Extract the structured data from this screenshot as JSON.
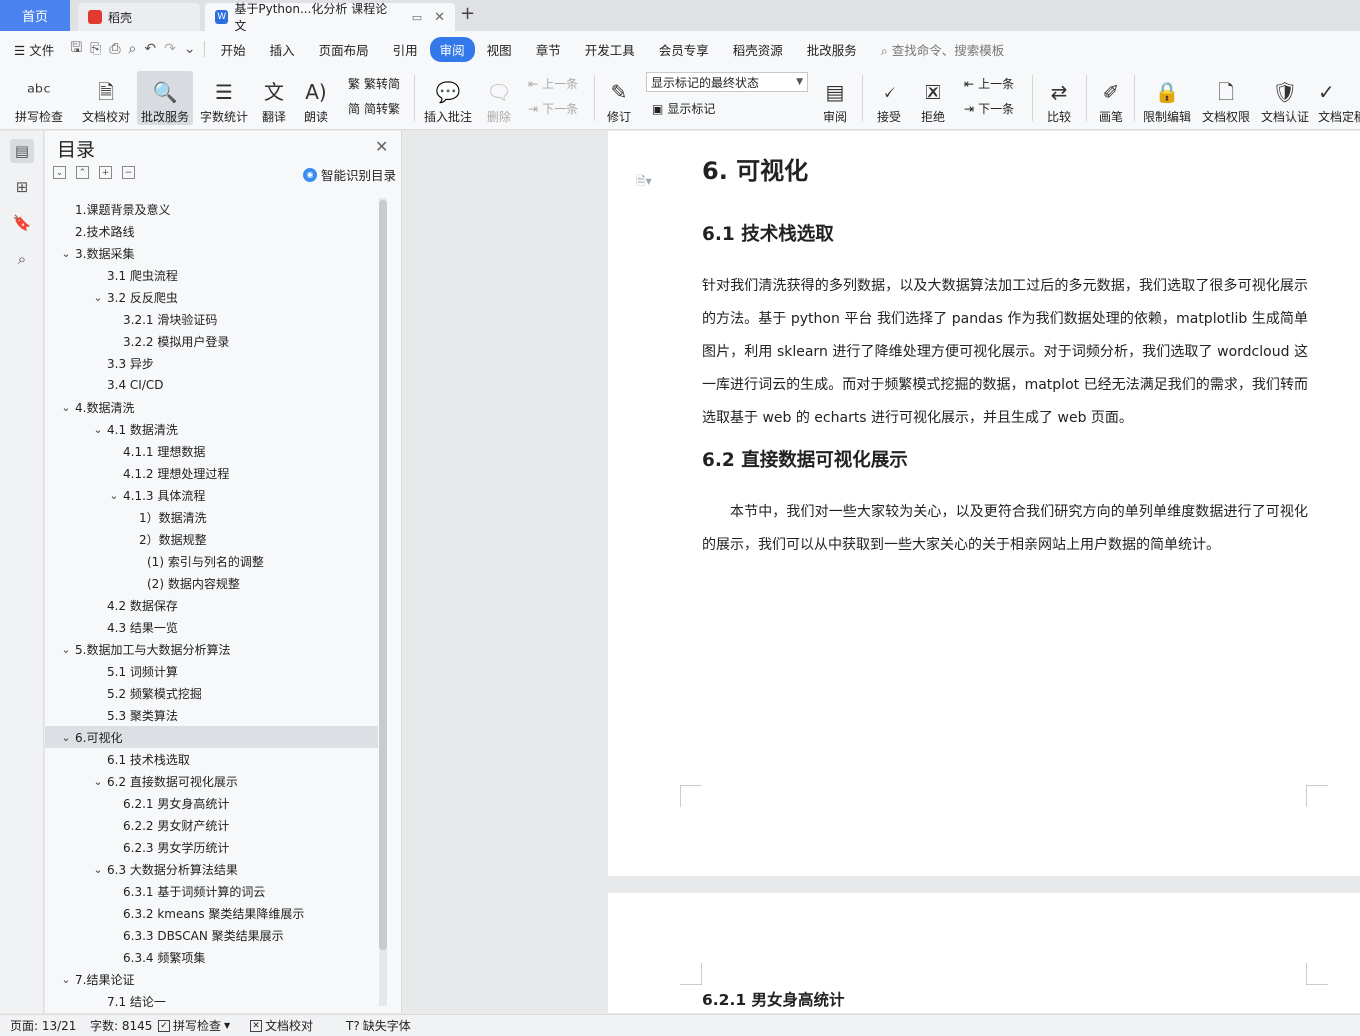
{
  "tabs": {
    "home": "首页",
    "daoke": "稻壳",
    "doc": "基于Python...化分析 课程论文"
  },
  "menu": {
    "file": "文件",
    "items": [
      "开始",
      "插入",
      "页面布局",
      "引用",
      "审阅",
      "视图",
      "章节",
      "开发工具",
      "会员专享",
      "稻壳资源",
      "批改服务"
    ],
    "active": "审阅",
    "search_placeholder": "查找命令、搜索模板"
  },
  "ribbon": {
    "spellcheck": "拼写检查",
    "doc_check": "文档校对",
    "review_service": "批改服务",
    "word_count": "字数统计",
    "translate": "翻译",
    "read_aloud": "朗读",
    "to_traditional": "繁转简",
    "to_simplified": "简转繁",
    "insert_comment": "插入批注",
    "delete": "删除",
    "prev": "上一条",
    "next": "下一条",
    "revise": "修订",
    "markup_state": "显示标记的最终状态",
    "show_markup": "显示标记",
    "review": "审阅",
    "accept": "接受",
    "reject": "拒绝",
    "prev2": "上一条",
    "next2": "下一条",
    "compare": "比较",
    "pen": "画笔",
    "restrict_edit": "限制编辑",
    "doc_permission": "文档权限",
    "doc_certify": "文档认证",
    "doc_final": "文档定稿"
  },
  "toc": {
    "title": "目录",
    "smart": "智能识别目录",
    "items": [
      {
        "label": "1.课题背景及意义",
        "level": 0,
        "caret": ""
      },
      {
        "label": "2.技术路线",
        "level": 0,
        "caret": ""
      },
      {
        "label": "3.数据采集",
        "level": 0,
        "caret": "v"
      },
      {
        "label": "3.1  爬虫流程",
        "level": 1,
        "caret": ""
      },
      {
        "label": "3.2  反反爬虫",
        "level": 1,
        "caret": "v"
      },
      {
        "label": "3.2.1  滑块验证码",
        "level": 2,
        "caret": ""
      },
      {
        "label": "3.2.2  模拟用户登录",
        "level": 2,
        "caret": ""
      },
      {
        "label": "3.3  异步",
        "level": 1,
        "caret": ""
      },
      {
        "label": "3.4 CI/CD",
        "level": 1,
        "caret": ""
      },
      {
        "label": "4.数据清洗",
        "level": 0,
        "caret": "v"
      },
      {
        "label": "4.1  数据清洗",
        "level": 1,
        "caret": "v"
      },
      {
        "label": "4.1.1  理想数据",
        "level": 2,
        "caret": ""
      },
      {
        "label": "4.1.2  理想处理过程",
        "level": 2,
        "caret": ""
      },
      {
        "label": "4.1.3  具体流程",
        "level": 2,
        "caret": "v"
      },
      {
        "label": "1）数据清洗",
        "level": 3,
        "caret": ""
      },
      {
        "label": "2）数据规整",
        "level": 3,
        "caret": ""
      },
      {
        "label": "(1)  索引与列名的调整",
        "level": 4,
        "caret": ""
      },
      {
        "label": "(2)  数据内容规整",
        "level": 4,
        "caret": ""
      },
      {
        "label": "4.2  数据保存",
        "level": 1,
        "caret": ""
      },
      {
        "label": "4.3  结果一览",
        "level": 1,
        "caret": ""
      },
      {
        "label": "5.数据加工与大数据分析算法",
        "level": 0,
        "caret": "v"
      },
      {
        "label": "5.1  词频计算",
        "level": 1,
        "caret": ""
      },
      {
        "label": "5.2  频繁模式挖掘",
        "level": 1,
        "caret": ""
      },
      {
        "label": "5.3  聚类算法",
        "level": 1,
        "caret": ""
      },
      {
        "label": "6.可视化",
        "level": 0,
        "caret": "v",
        "highlight": true
      },
      {
        "label": "6.1  技术栈选取",
        "level": 1,
        "caret": ""
      },
      {
        "label": "6.2  直接数据可视化展示",
        "level": 1,
        "caret": "v"
      },
      {
        "label": "6.2.1  男女身高统计",
        "level": 2,
        "caret": ""
      },
      {
        "label": "6.2.2  男女财产统计",
        "level": 2,
        "caret": ""
      },
      {
        "label": "6.2.3  男女学历统计",
        "level": 2,
        "caret": ""
      },
      {
        "label": "6.3  大数据分析算法结果",
        "level": 1,
        "caret": "v"
      },
      {
        "label": "6.3.1  基于词频计算的词云",
        "level": 2,
        "caret": ""
      },
      {
        "label": "6.3.2 kmeans 聚类结果降维展示",
        "level": 2,
        "caret": ""
      },
      {
        "label": "6.3.3 DBSCAN 聚类结果展示",
        "level": 2,
        "caret": ""
      },
      {
        "label": "6.3.4  频繁项集",
        "level": 2,
        "caret": ""
      },
      {
        "label": "7.结果论证",
        "level": 0,
        "caret": "v"
      },
      {
        "label": "7.1  结论一",
        "level": 1,
        "caret": ""
      }
    ]
  },
  "doc": {
    "h1": "6. 可视化",
    "h2a": "6.1  技术栈选取",
    "para1": "针对我们清洗获得的多列数据，以及大数据算法加工过后的多元数据，我们选取了很多可视化展示的方法。基于 python 平台 我们选择了 pandas 作为我们数据处理的依赖，matplotlib 生成简单图片，利用 sklearn 进行了降维处理方便可视化展示。对于词频分析，我们选取了 wordcloud 这一库进行词云的生成。而对于频繁模式挖掘的数据，matplot 已经无法满足我们的需求，我们转而选取基于 web 的 echarts 进行可视化展示，并且生成了 web 页面。",
    "h2b": "6.2  直接数据可视化展示",
    "para2": "本节中，我们对一些大家较为关心，以及更符合我们研究方向的单列单维度数据进行了可视化的展示，我们可以从中获取到一些大家关心的关于相亲网站上用户数据的简单统计。",
    "h3": "6.2.1  男女身高统计"
  },
  "status": {
    "page": "页面: 13/21",
    "words": "字数: 8145",
    "spellcheck": "拼写检查",
    "doc_check": "文档校对",
    "missing_font": "缺失字体"
  },
  "colors": {
    "accent": "#3479e9",
    "home_tab": "#4a83f0"
  }
}
